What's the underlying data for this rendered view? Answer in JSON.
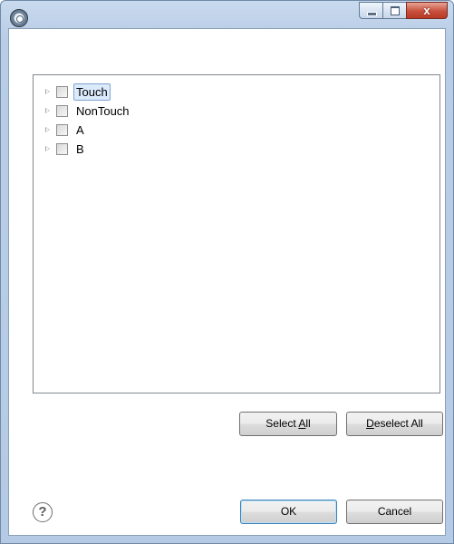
{
  "window": {
    "title": "",
    "controls": {
      "minimize_icon": "minimize-icon",
      "maximize_icon": "maximize-icon",
      "close_glyph": "x"
    }
  },
  "tree": {
    "items": [
      {
        "label": "Touch",
        "checked": false,
        "selected": true,
        "expandable": true
      },
      {
        "label": "NonTouch",
        "checked": false,
        "selected": false,
        "expandable": true
      },
      {
        "label": "A",
        "checked": false,
        "selected": false,
        "expandable": true
      },
      {
        "label": "B",
        "checked": false,
        "selected": false,
        "expandable": true
      }
    ]
  },
  "buttons": {
    "select_all": "Select All",
    "select_all_mnemonic": "A",
    "deselect_all": "Deselect All",
    "deselect_all_mnemonic": "D",
    "ok": "OK",
    "cancel": "Cancel"
  },
  "help": {
    "glyph": "?"
  },
  "colors": {
    "title_bar": "#b9cde6",
    "close_button": "#c9503c",
    "selection": "#dcebfc"
  }
}
